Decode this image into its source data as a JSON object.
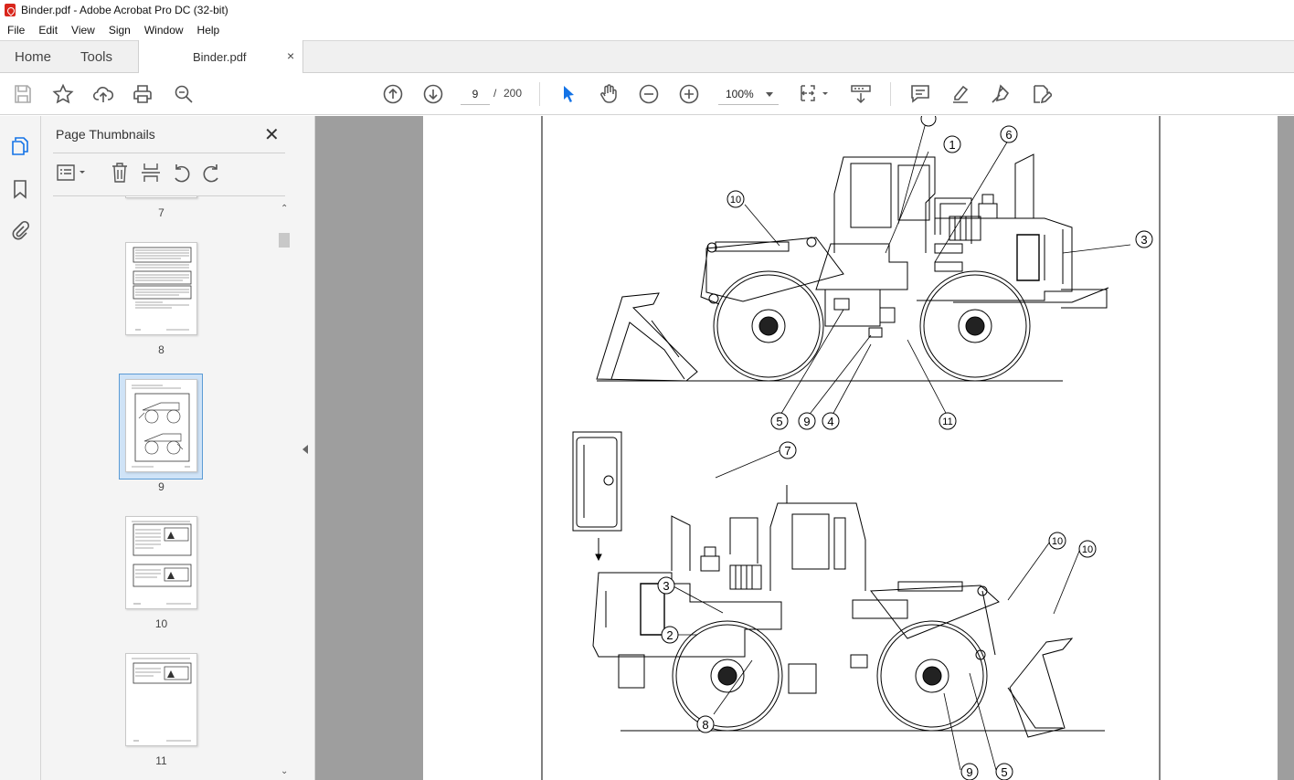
{
  "window": {
    "title": "Binder.pdf - Adobe Acrobat Pro DC (32-bit)"
  },
  "menu": [
    "File",
    "Edit",
    "View",
    "Sign",
    "Window",
    "Help"
  ],
  "tabs": {
    "home": "Home",
    "tools": "Tools",
    "document": "Binder.pdf",
    "close": "×"
  },
  "toolbar": {
    "current_page": "9",
    "separator": "/",
    "total_pages": "200",
    "zoom": "100%"
  },
  "panel": {
    "title": "Page Thumbnails",
    "close": "✕",
    "thumbnails": [
      {
        "page": "7"
      },
      {
        "page": "8"
      },
      {
        "page": "9",
        "selected": true
      },
      {
        "page": "10"
      },
      {
        "page": "11"
      }
    ]
  },
  "callouts": {
    "top": [
      "1",
      "6",
      "10",
      "3",
      "5",
      "9",
      "4",
      "11"
    ],
    "bottom": [
      "7",
      "3",
      "2",
      "8",
      "10",
      "10",
      "9",
      "5"
    ]
  },
  "colors": {
    "accent": "#1473e6",
    "selection": "#cfe3f7",
    "doc_bg": "#9e9e9e",
    "acrobat_red": "#d9261c"
  }
}
